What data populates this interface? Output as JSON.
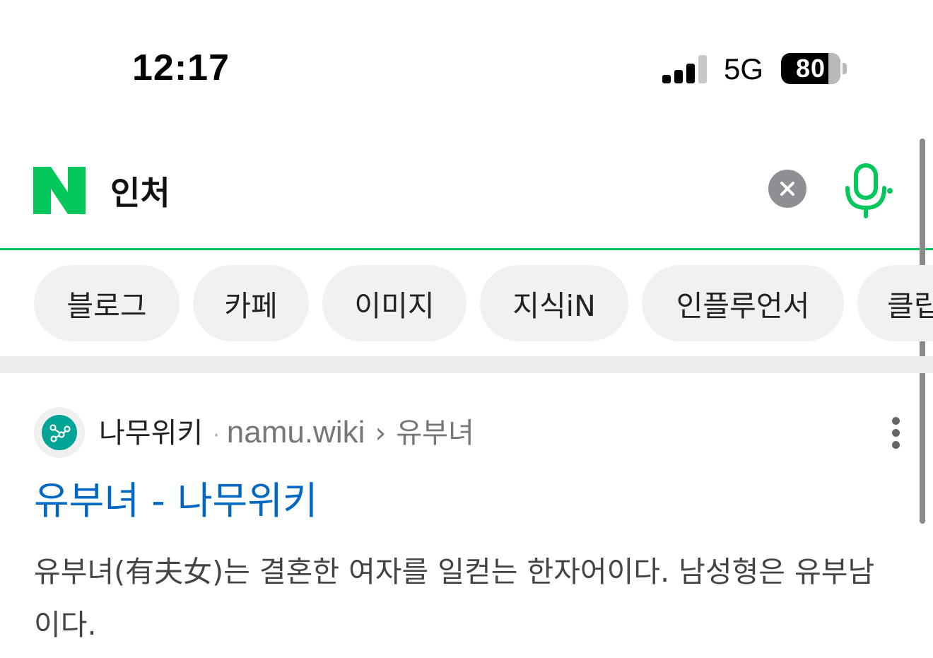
{
  "status_bar": {
    "time": "12:17",
    "network": "5G",
    "battery": "80"
  },
  "search": {
    "logo": "N",
    "query": "인처",
    "clear_icon": "close-icon",
    "mic_icon": "microphone-icon",
    "accent_color": "#03c75a"
  },
  "tabs": [
    {
      "label": "블로그"
    },
    {
      "label": "카페"
    },
    {
      "label": "이미지"
    },
    {
      "label": "지식iN"
    },
    {
      "label": "인플루언서"
    },
    {
      "label": "클립"
    }
  ],
  "result": {
    "source_name": "나무위키",
    "source_separator": "·",
    "source_url": "namu.wiki",
    "source_arrow": "›",
    "source_path": "유부녀",
    "title": "유부녀 - 나무위키",
    "snippet": "유부녀(有夫女)는 결혼한 여자를 일컫는 한자어이다. 남성형은 유부남이다.",
    "title_color": "#0068c3",
    "favicon_color": "#00a495"
  }
}
